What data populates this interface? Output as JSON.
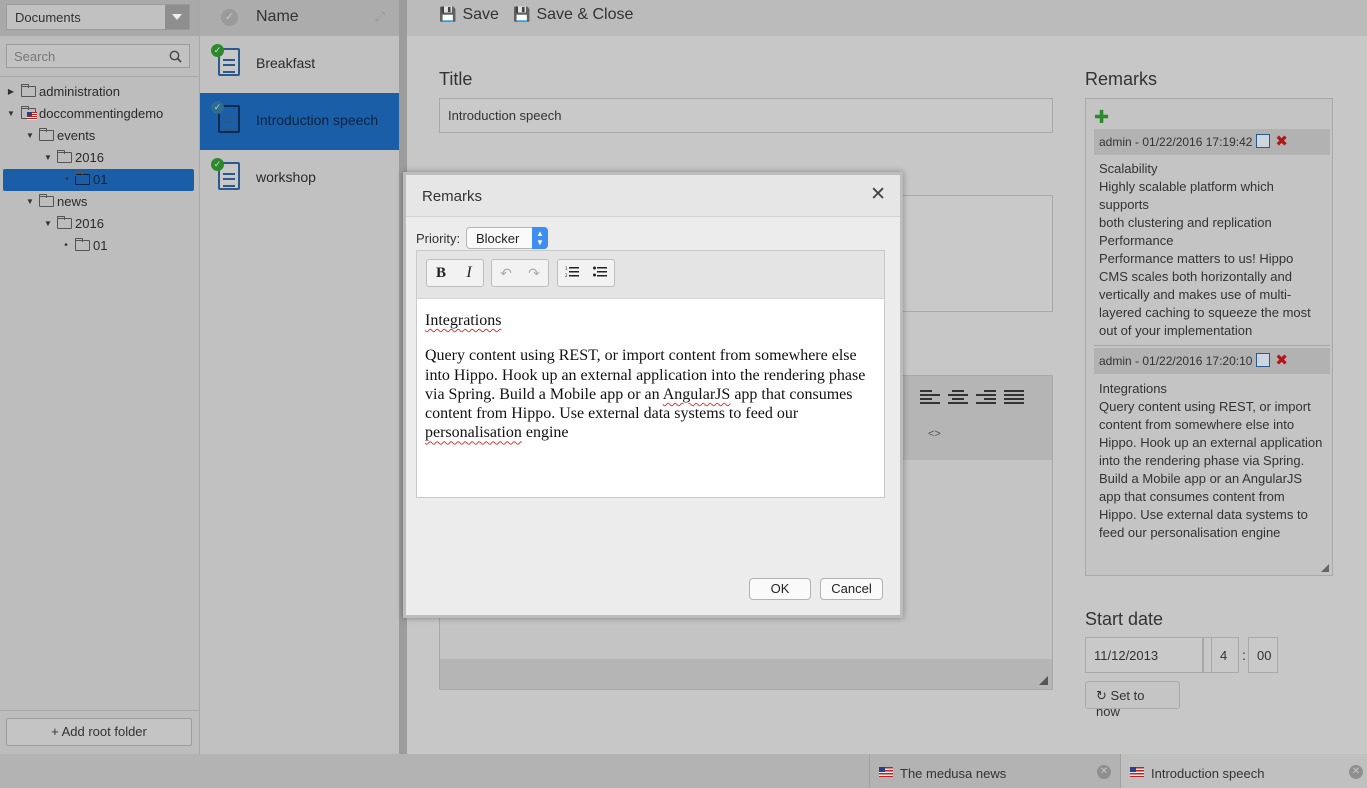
{
  "folders": {
    "selector": "Documents",
    "search_placeholder": "Search",
    "tree": [
      {
        "label": "administration"
      },
      {
        "label": "doccommentingdemo"
      },
      {
        "label": "events"
      },
      {
        "label": "2016"
      },
      {
        "label": "01"
      },
      {
        "label": "news"
      },
      {
        "label": "2016"
      },
      {
        "label": "01"
      }
    ],
    "add_root": "+ Add root folder"
  },
  "doclist": {
    "header": "Name",
    "items": [
      {
        "label": "Breakfast"
      },
      {
        "label": "Introduction speech"
      },
      {
        "label": "workshop"
      }
    ]
  },
  "editor": {
    "save": "Save",
    "save_close": "Save & Close",
    "title_label": "Title",
    "title_value": "Introduction speech",
    "remarks_label": "Remarks",
    "remarks": [
      {
        "meta": "admin - 01/22/2016 17:19:42",
        "text": "Scalability\nHighly scalable platform which supports\nboth clustering and replication\nPerformance\nPerformance matters to us! Hippo CMS  scales both  horizontally and vertically and makes use of  multi-layered caching to squeeze the most out of your implementation"
      },
      {
        "meta": "admin - 01/22/2016 17:20:10",
        "text": "Integrations\nQuery content using REST, or import content from somewhere else into Hippo. Hook up an external application into the rendering phase via Spring. Build a Mobile app or an AngularJS app that consumes content from Hippo. Use external data systems to feed our personalisation engine"
      }
    ],
    "start_date_label": "Start date",
    "date_value": "11/12/2013",
    "hour_value": "4",
    "minute_value": "00",
    "time_sep": ":",
    "set_now": "Set to now",
    "code_btn": "<>"
  },
  "tabs": [
    {
      "label": "The medusa news"
    },
    {
      "label": "Introduction speech"
    }
  ],
  "modal": {
    "title": "Remarks",
    "priority_label": "Priority:",
    "priority_value": "Blocker",
    "content": {
      "heading": "Integrations",
      "body_1": "Query content using REST, or import content from somewhere else into Hippo. Hook up an external application into the rendering phase via Spring. Build a Mobile app or an ",
      "angular": "AngularJS",
      "body_2": " app that consumes content from Hippo. Use external data systems to feed our ",
      "personalisation": "personalisation",
      "body_3": " engine"
    },
    "ok": "OK",
    "cancel": "Cancel"
  },
  "colors": {
    "selection": "#1a5ea8",
    "ok_check": "#2c8a2c",
    "delete": "#b01818",
    "spinner": "#3d8ef0"
  }
}
